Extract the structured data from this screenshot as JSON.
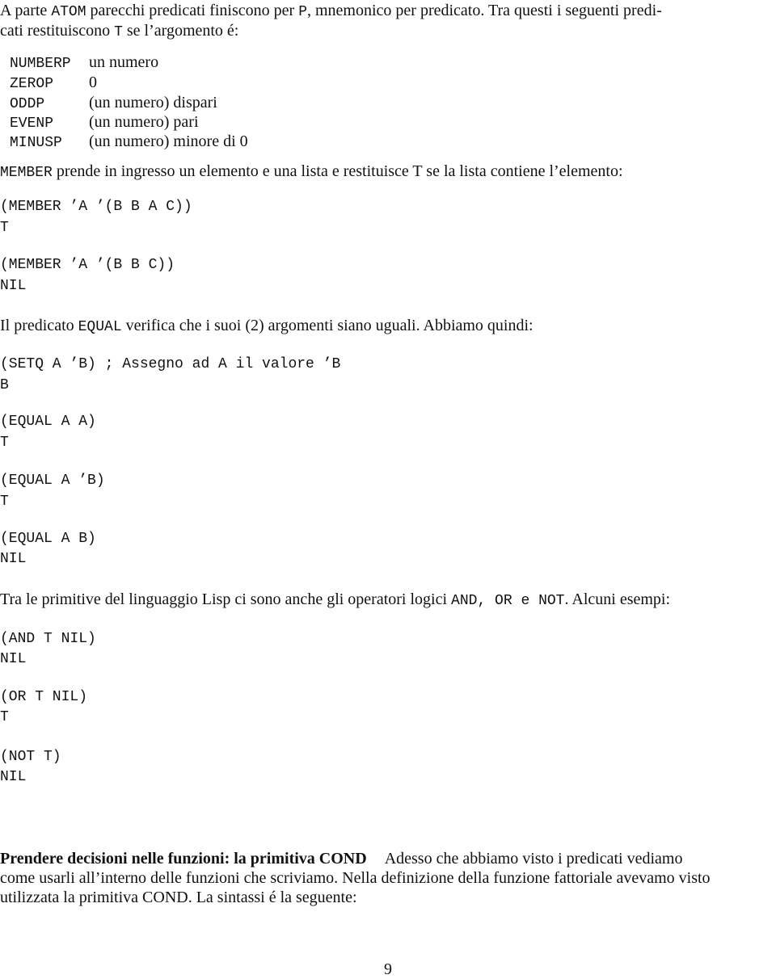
{
  "intro": {
    "line1": {
      "t1": "A parte ",
      "c1": "ATOM",
      "t2": " parecchi predicati finiscono per ",
      "c2": "P",
      "t3": ", mnemonico per predicato.  Tra questi i seguenti predi-"
    },
    "line2": {
      "t1": "cati restituiscono ",
      "c1": "T",
      "t2": " se l’argomento é:"
    }
  },
  "predicates": [
    {
      "name": "NUMBERP",
      "desc": "un numero"
    },
    {
      "name": "ZEROP",
      "desc": "0"
    },
    {
      "name": "ODDP",
      "desc": "(un numero) dispari"
    },
    {
      "name": "EVENP",
      "desc": "(un numero) pari"
    },
    {
      "name": "MINUSP",
      "desc": "(un numero) minore di 0"
    }
  ],
  "member_para": {
    "c1": "MEMBER",
    "t1": " prende in ingresso un elemento e una lista e restituisce T se la lista contiene l’elemento:"
  },
  "member_examples": [
    {
      "code": "(MEMBER ’A ’(B B A C))",
      "result": "T"
    },
    {
      "code": "(MEMBER ’A ’(B B C))",
      "result": "NIL"
    }
  ],
  "equal_para": {
    "t1": "Il predicato ",
    "c1": "EQUAL",
    "t2": " verifica che i suoi (2) argomenti siano uguali. Abbiamo quindi:"
  },
  "equal_examples": [
    {
      "code": "(SETQ A ’B) ; Assegno ad A il valore ’B",
      "result": "B"
    },
    {
      "code": "(EQUAL A A)",
      "result": "T"
    },
    {
      "code": "(EQUAL A ’B)",
      "result": "T"
    },
    {
      "code": "(EQUAL A B)",
      "result": "NIL"
    }
  ],
  "logic_para": {
    "t1": "Tra le primitive del linguaggio Lisp ci sono anche gli operatori logici ",
    "c1": "AND, OR e NOT",
    "t2": ". Alcuni esempi:"
  },
  "logic_examples": [
    {
      "code": "(AND T NIL)",
      "result": "NIL"
    },
    {
      "code": "(OR T NIL)",
      "result": "T"
    },
    {
      "code": "(NOT T)",
      "result": "NIL"
    }
  ],
  "cond_section": {
    "heading": "Prendere decisioni nelle funzioni: la primitiva COND",
    "line1_rest": "Adesso che abbiamo visto i predicati vediamo",
    "line2": "come usarli all’interno delle funzioni che scriviamo. Nella definizione della funzione fattoriale avevamo visto",
    "line3": "utilizzata la primitiva COND. La sintassi é la seguente:"
  },
  "page_number": "9"
}
